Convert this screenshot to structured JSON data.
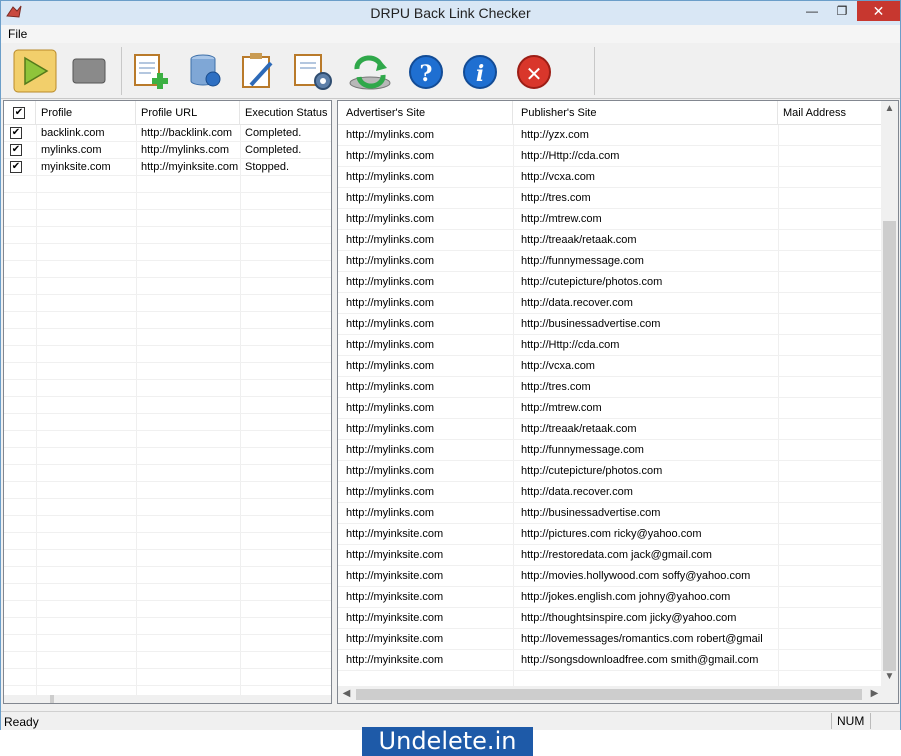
{
  "window": {
    "title": "DRPU Back Link Checker",
    "minimize_glyph": "—",
    "maximize_glyph": "❐",
    "close_glyph": "✕"
  },
  "menu": {
    "file_label": "File"
  },
  "toolbar": {
    "buttons": [
      {
        "name": "start-icon"
      },
      {
        "name": "stop-icon"
      },
      {
        "name": "add-profile-icon"
      },
      {
        "name": "database-icon"
      },
      {
        "name": "edit-profile-icon"
      },
      {
        "name": "settings-clipboard-icon"
      },
      {
        "name": "refresh-icon"
      },
      {
        "name": "help-icon",
        "glyph": "?"
      },
      {
        "name": "info-icon",
        "glyph": "i"
      },
      {
        "name": "exit-icon",
        "glyph": "✕"
      }
    ]
  },
  "profiles": {
    "select_all_checked": true,
    "columns": [
      "Profile",
      "Profile URL",
      "Execution Status"
    ],
    "rows": [
      {
        "checked": true,
        "profile": "backlink.com",
        "url": "http://backlink.com",
        "status": "Completed."
      },
      {
        "checked": true,
        "profile": "mylinks.com",
        "url": "http://mylinks.com",
        "status": "Completed."
      },
      {
        "checked": true,
        "profile": "myinksite.com",
        "url": "http://myinksite.com",
        "status": "Stopped."
      }
    ]
  },
  "results": {
    "columns": [
      "Advertiser's Site",
      "Publisher's Site",
      "Mail Address"
    ],
    "rows": [
      {
        "advertiser": "http://mylinks.com",
        "publisher": "http://yzx.com"
      },
      {
        "advertiser": "http://mylinks.com",
        "publisher": "http://Http://cda.com"
      },
      {
        "advertiser": "http://mylinks.com",
        "publisher": "http://vcxa.com"
      },
      {
        "advertiser": "http://mylinks.com",
        "publisher": "http://tres.com"
      },
      {
        "advertiser": "http://mylinks.com",
        "publisher": "http://mtrew.com"
      },
      {
        "advertiser": "http://mylinks.com",
        "publisher": "http://treaak/retaak.com"
      },
      {
        "advertiser": "http://mylinks.com",
        "publisher": "http://funnymessage.com"
      },
      {
        "advertiser": "http://mylinks.com",
        "publisher": "http://cutepicture/photos.com"
      },
      {
        "advertiser": "http://mylinks.com",
        "publisher": "http://data.recover.com"
      },
      {
        "advertiser": "http://mylinks.com",
        "publisher": "http://businessadvertise.com"
      },
      {
        "advertiser": "http://mylinks.com",
        "publisher": "http://Http://cda.com"
      },
      {
        "advertiser": "http://mylinks.com",
        "publisher": "http://vcxa.com"
      },
      {
        "advertiser": "http://mylinks.com",
        "publisher": "http://tres.com"
      },
      {
        "advertiser": "http://mylinks.com",
        "publisher": "http://mtrew.com"
      },
      {
        "advertiser": "http://mylinks.com",
        "publisher": "http://treaak/retaak.com"
      },
      {
        "advertiser": "http://mylinks.com",
        "publisher": "http://funnymessage.com"
      },
      {
        "advertiser": "http://mylinks.com",
        "publisher": "http://cutepicture/photos.com"
      },
      {
        "advertiser": "http://mylinks.com",
        "publisher": "http://data.recover.com"
      },
      {
        "advertiser": "http://mylinks.com",
        "publisher": "http://businessadvertise.com"
      },
      {
        "advertiser": "http://myinksite.com",
        "publisher": "http://pictures.com ricky@yahoo.com"
      },
      {
        "advertiser": "http://myinksite.com",
        "publisher": "http://restoredata.com jack@gmail.com"
      },
      {
        "advertiser": "http://myinksite.com",
        "publisher": "http://movies.hollywood.com soffy@yahoo.com"
      },
      {
        "advertiser": "http://myinksite.com",
        "publisher": "http://jokes.english.com johny@yahoo.com"
      },
      {
        "advertiser": "http://myinksite.com",
        "publisher": "http://thoughtsinspire.com jicky@yahoo.com"
      },
      {
        "advertiser": "http://myinksite.com",
        "publisher": "http://lovemessages/romantics.com robert@gmail"
      },
      {
        "advertiser": "http://myinksite.com",
        "publisher": "http://songsdownloadfree.com smith@gmail.com"
      }
    ]
  },
  "status": {
    "text": "Ready",
    "num": "NUM"
  },
  "watermark": {
    "text": "Undelete.in"
  },
  "colors": {
    "close": "#c7372f",
    "help": "#1f6fd1",
    "exit": "#d9362b",
    "start": "#e0b84a",
    "watermark": "#1e5aa8"
  }
}
